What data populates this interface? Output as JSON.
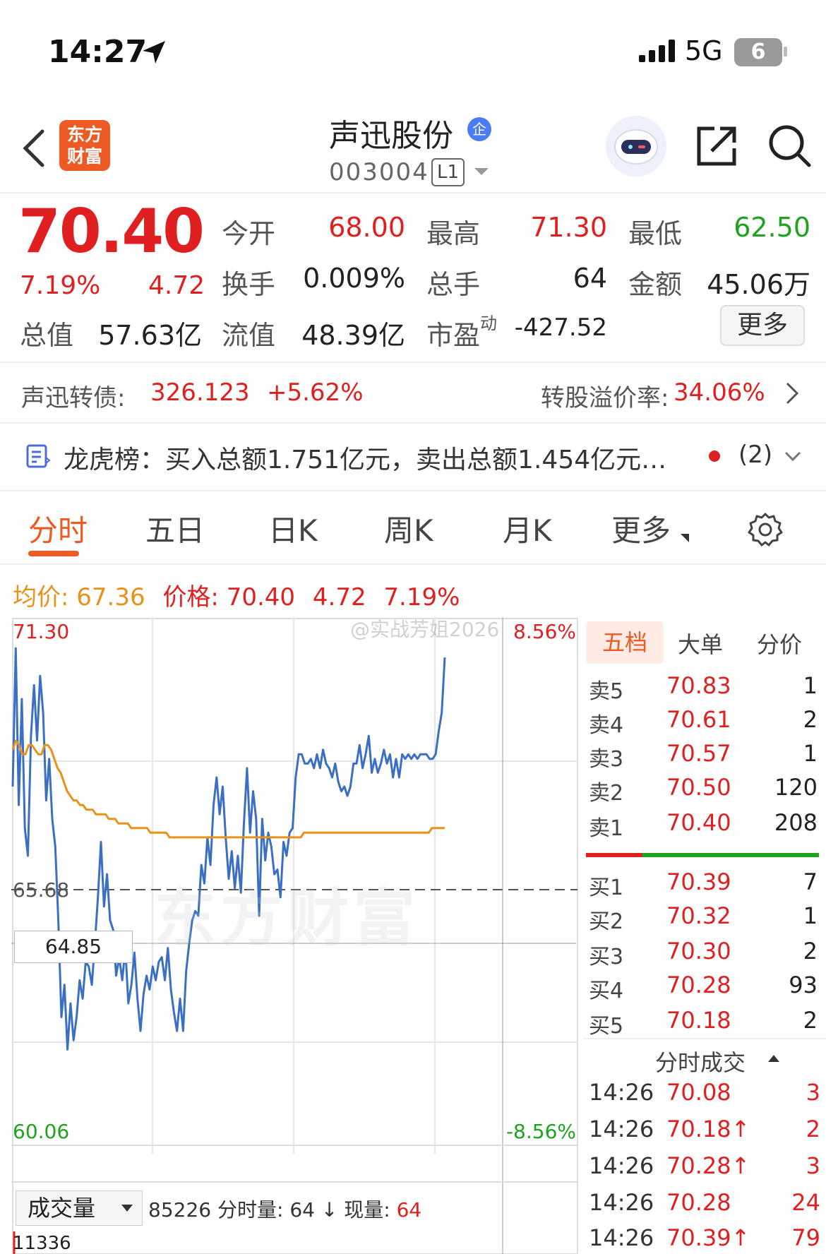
{
  "status_bar": {
    "time": "14:27",
    "network": "5G",
    "battery": "6"
  },
  "header": {
    "logo_text": "东方财富",
    "stock_name": "声迅股份",
    "qi_badge": "企",
    "stock_code": "003004",
    "level_badge": "L1"
  },
  "quote": {
    "price": "70.40",
    "change_pct": "7.19%",
    "change": "4.72",
    "open_label": "今开",
    "open": "68.00",
    "high_label": "最高",
    "high": "71.30",
    "low_label": "最低",
    "low": "62.50",
    "turnover_label": "换手",
    "turnover": "0.009%",
    "volume_label": "总手",
    "volume": "64",
    "amount_label": "金额",
    "amount": "45.06万",
    "mcap_label": "总值",
    "mcap": "57.63亿",
    "float_label": "流值",
    "float_cap": "48.39亿",
    "pe_label": "市盈",
    "pe_sup": "动",
    "pe": "-427.52",
    "more_button": "更多"
  },
  "bond": {
    "label": "声迅转债:",
    "price": "326.123",
    "change": "+5.62%",
    "premium_label": "转股溢价率:",
    "premium": "34.06%"
  },
  "dragon_tiger": {
    "text": "龙虎榜：买入总额1.751亿元，卖出总额1.454亿元…",
    "count": "(2)"
  },
  "tabs": [
    "分时",
    "五日",
    "日K",
    "周K",
    "月K",
    "更多"
  ],
  "avg_row": {
    "avg_label": "均价:",
    "avg": "67.36",
    "price_label": "价格:",
    "price": "70.40",
    "change": "4.72",
    "pct": "7.19%"
  },
  "watermark": "@实战芳姐2026",
  "bg_watermark": "东方财富",
  "chart_data": {
    "type": "line",
    "y_top": "71.30",
    "y_mid": "65.68",
    "y_bottom": "60.06",
    "pct_top": "8.56%",
    "pct_bottom": "-8.56%",
    "ylim": [
      60.06,
      71.3
    ],
    "prev_close": 65.68,
    "crosshair_value": "64.85",
    "series": [
      {
        "values": [
          67.9,
          70.9,
          67.5,
          69.8,
          67.0,
          66.4,
          69.0,
          70.1,
          68.9,
          70.3,
          69.5,
          67.6,
          68.5,
          67.2,
          66.6,
          65.0,
          62.9,
          63.6,
          62.2,
          63.2,
          62.4,
          62.9,
          63.7,
          63.3,
          64.1,
          64.0,
          63.6,
          64.5,
          65.5,
          66.7,
          65.3,
          66.0,
          65.0,
          64.8,
          63.8,
          64.2,
          63.7,
          64.4,
          63.2,
          63.6,
          64.3,
          63.3,
          62.6,
          63.4,
          63.8,
          63.5,
          64.0,
          63.7,
          64.1,
          64.2,
          63.7,
          64.4,
          63.5,
          63.0,
          62.6,
          63.3,
          62.6,
          63.9,
          64.5,
          65.0,
          65.2,
          65.1,
          66.2,
          65.8,
          66.8,
          66.2,
          67.5,
          68.1,
          67.3,
          67.9,
          66.8,
          65.9,
          66.5,
          65.7,
          66.4,
          65.6,
          67.1,
          68.3,
          66.9,
          67.8,
          67.2,
          65.1,
          67.2,
          66.3,
          66.9,
          66.6,
          66.0,
          66.1,
          65.5,
          66.7,
          66.4,
          66.9,
          67.0,
          68.1,
          68.6,
          68.6,
          68.4,
          68.4,
          68.5,
          68.3,
          68.6,
          68.3,
          68.7,
          68.4,
          68.3,
          68.1,
          68.4,
          68.0,
          67.8,
          67.9,
          67.7,
          67.9,
          68.4,
          68.4,
          68.8,
          68.3,
          68.6,
          69.0,
          68.2,
          68.5,
          68.2,
          68.4,
          68.7,
          68.4,
          68.6,
          68.1,
          68.5,
          68.1,
          68.6,
          68.5,
          68.6,
          68.5,
          68.6,
          68.5,
          68.6,
          68.6,
          68.6,
          68.5,
          68.5,
          68.6,
          69.1,
          69.5,
          70.7
        ]
      },
      {
        "values": [
          68.7,
          68.9,
          68.8,
          68.6,
          68.6,
          68.8,
          68.8,
          68.7,
          68.6,
          68.6,
          68.8,
          68.8,
          68.7,
          68.5,
          68.3,
          68.2,
          68.0,
          67.8,
          67.7,
          67.6,
          67.6,
          67.5,
          67.5,
          67.4,
          67.4,
          67.4,
          67.3,
          67.3,
          67.3,
          67.3,
          67.2,
          67.2,
          67.2,
          67.1,
          67.1,
          67.1,
          67.1,
          67.0,
          67.0,
          67.0,
          67.0,
          67.0,
          67.0,
          66.9,
          66.9,
          66.9,
          66.9,
          66.9,
          66.9,
          66.8,
          66.8,
          66.8,
          66.8,
          66.8,
          66.8,
          66.8,
          66.8,
          66.8,
          66.8,
          66.8,
          66.8,
          66.8,
          66.8,
          66.8,
          66.8,
          66.8,
          66.8,
          66.8,
          66.8,
          66.8,
          66.8,
          66.8,
          66.8,
          66.8,
          66.8,
          66.8,
          66.8,
          66.8,
          66.8,
          66.8,
          66.8,
          66.8,
          66.8,
          66.8,
          66.8,
          66.8,
          66.8,
          66.8,
          66.8,
          66.8,
          66.8,
          66.9,
          66.9,
          66.9,
          66.9,
          66.9,
          66.9,
          66.9,
          66.9,
          66.9,
          66.9,
          66.9,
          66.9,
          66.9,
          66.9,
          66.9,
          66.9,
          66.9,
          66.9,
          66.9,
          66.9,
          66.9,
          66.9,
          66.9,
          66.9,
          66.9,
          66.9,
          66.9,
          66.9,
          66.9,
          66.9,
          66.9,
          66.9,
          66.9,
          66.9,
          66.9,
          66.9,
          66.9,
          66.9,
          66.9,
          66.9,
          67.0,
          67.0,
          67.0,
          67.0,
          67.0
        ]
      }
    ]
  },
  "volume_panel": {
    "selector": "成交量",
    "total": "85226",
    "fenshi_label": "分时量: 64",
    "now_label": "现量:",
    "now": "64",
    "axis_top": "11336"
  },
  "order_book": {
    "tabs": [
      "五档",
      "大单",
      "分价"
    ],
    "asks": [
      {
        "label": "卖5",
        "price": "70.83",
        "vol": "1"
      },
      {
        "label": "卖4",
        "price": "70.61",
        "vol": "2"
      },
      {
        "label": "卖3",
        "price": "70.57",
        "vol": "1"
      },
      {
        "label": "卖2",
        "price": "70.50",
        "vol": "120"
      },
      {
        "label": "卖1",
        "price": "70.40",
        "vol": "208"
      }
    ],
    "bids": [
      {
        "label": "买1",
        "price": "70.39",
        "vol": "7"
      },
      {
        "label": "买2",
        "price": "70.32",
        "vol": "1"
      },
      {
        "label": "买3",
        "price": "70.30",
        "vol": "2"
      },
      {
        "label": "买4",
        "price": "70.28",
        "vol": "93"
      },
      {
        "label": "买5",
        "price": "70.18",
        "vol": "2"
      }
    ],
    "ticks_header": "分时成交",
    "ticks": [
      {
        "time": "14:26",
        "price": "70.08",
        "vol": "3"
      },
      {
        "time": "14:26",
        "price": "70.18↑",
        "vol": "2"
      },
      {
        "time": "14:26",
        "price": "70.28↑",
        "vol": "3"
      },
      {
        "time": "14:26",
        "price": "70.28",
        "vol": "24"
      },
      {
        "time": "14:26",
        "price": "70.39↑",
        "vol": "79"
      }
    ]
  },
  "colors": {
    "up": "#e02020",
    "down": "#1fa31f",
    "accent": "#ee5a24",
    "price_line": "#3a6fc4",
    "avg_line": "#e8921a"
  }
}
